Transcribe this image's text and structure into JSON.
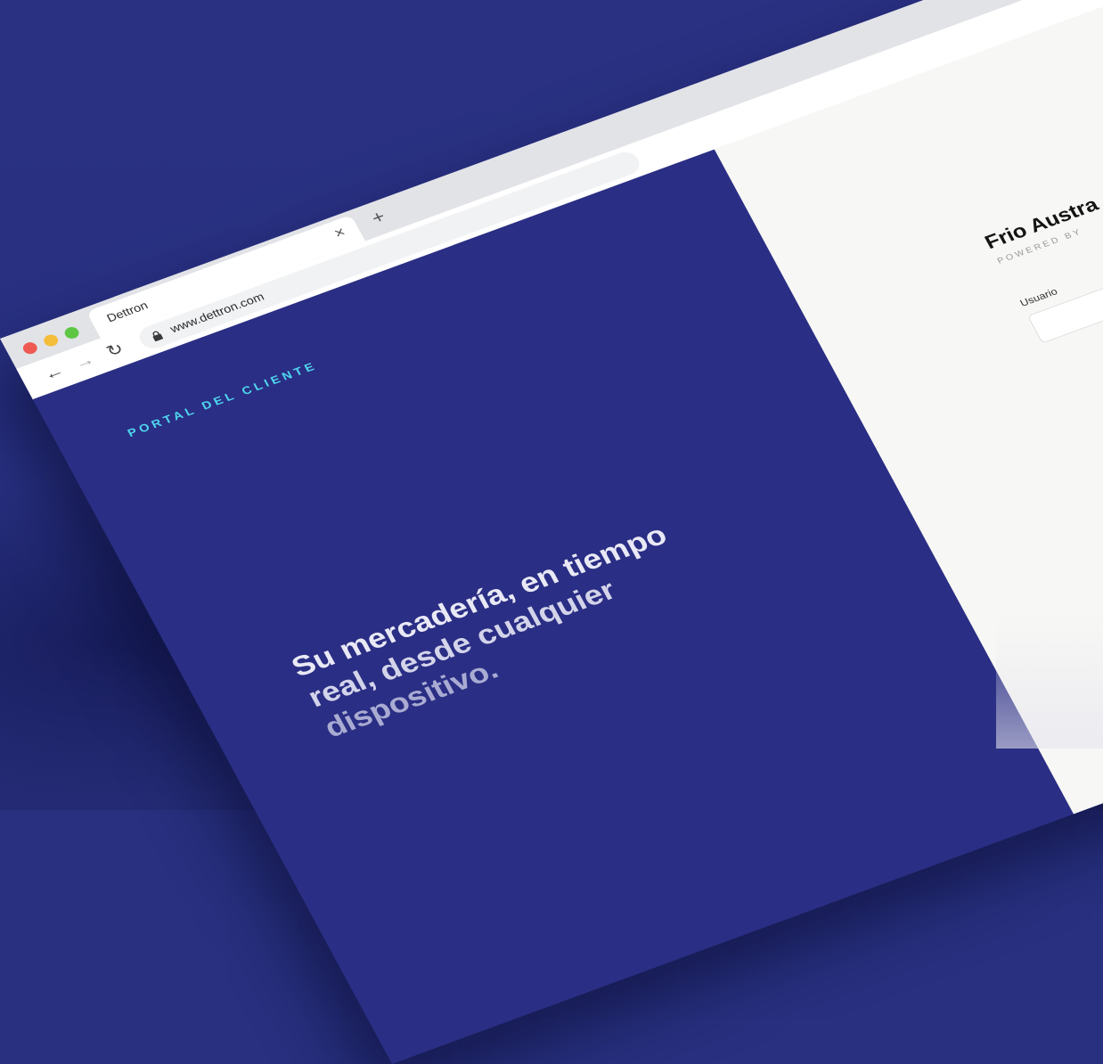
{
  "browser": {
    "tab_title": "Dettron",
    "tab_close_glyph": "×",
    "new_tab_glyph": "+",
    "url": "www.dettron.com",
    "icons": {
      "back": "←",
      "forward": "→",
      "reload": "↻"
    }
  },
  "hero": {
    "eyebrow": "PORTAL DEL CLIENTE",
    "headline_lines": [
      "Su mercadería, en tiempo",
      "real, desde cualquier",
      "dispositivo."
    ]
  },
  "login": {
    "company": "Frio Austra",
    "powered_by": "POWERED BY",
    "username_label": "Usuario"
  },
  "colors": {
    "background": "#28307f",
    "hero_panel": "#2a2e84",
    "eyebrow": "#4fd6ef",
    "login_panel": "#f7f7f5"
  }
}
